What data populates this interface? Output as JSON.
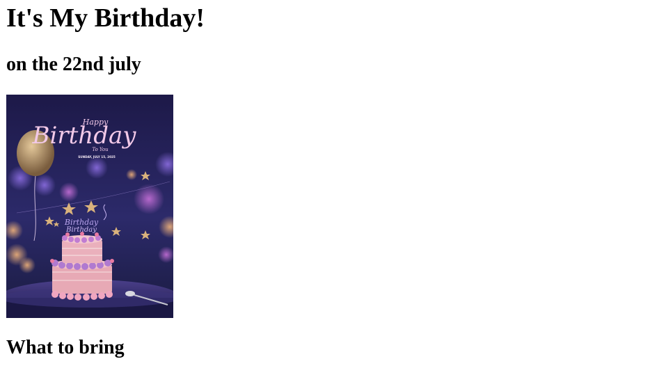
{
  "page": {
    "title": "It's My Birthday!",
    "subtitle": "on the 22nd july",
    "section_heading": "What to bring"
  },
  "poster": {
    "script_top": "Happy",
    "script_main": "Birthday",
    "script_bottom": "To You",
    "date_line": "SUNDAY, JULY 15, 2025",
    "topper_text": "Birthday",
    "colors": {
      "background": "#1f1c4e",
      "script": "#f2c9e8",
      "cake": "#e8a8b8",
      "frosting": "#b07ad0",
      "star": "#d9b27c"
    }
  }
}
